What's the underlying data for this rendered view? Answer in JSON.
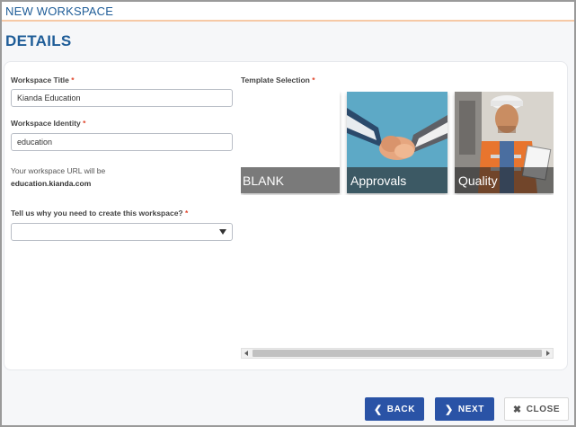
{
  "window": {
    "title": "NEW WORKSPACE"
  },
  "page": {
    "heading": "DETAILS"
  },
  "form": {
    "workspace_title": {
      "label": "Workspace Title",
      "required": "*",
      "value": "Kianda Education"
    },
    "workspace_identity": {
      "label": "Workspace Identity",
      "required": "*",
      "value": "education"
    },
    "url_hint": {
      "line1": "Your workspace URL will be",
      "line2": "education.kianda.com"
    },
    "reason": {
      "label": "Tell us why you need to create this workspace?",
      "required": "*",
      "value": ""
    }
  },
  "templates": {
    "label": "Template Selection",
    "required": "*",
    "items": [
      {
        "name": "BLANK"
      },
      {
        "name": "Approvals"
      },
      {
        "name": "Quality"
      }
    ]
  },
  "footer": {
    "back_label": "BACK",
    "next_label": "NEXT",
    "close_label": "CLOSE",
    "back_icon": "chevron-left-icon",
    "next_icon": "chevron-right-icon",
    "close_icon": "close-icon"
  },
  "colors": {
    "brand": "#1f5d98",
    "primary_button": "#2a53a6",
    "required": "#e0452b"
  }
}
